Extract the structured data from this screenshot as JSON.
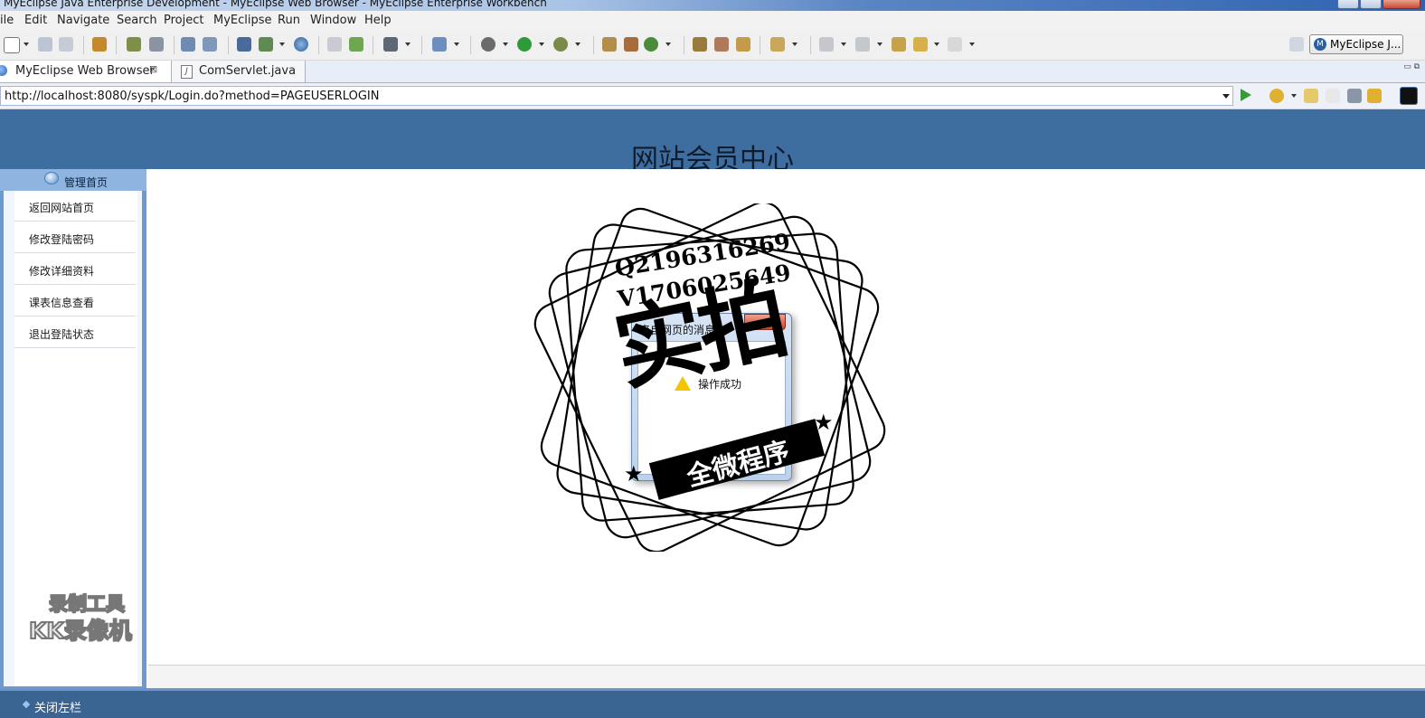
{
  "window": {
    "title": "MyEclipse Java Enterprise Development - MyEclipse Web Browser - MyEclipse Enterprise Workbench"
  },
  "menu": [
    "ile",
    "Edit",
    "Navigate",
    "Search",
    "Project",
    "MyEclipse",
    "Run",
    "Window",
    "Help"
  ],
  "perspective": {
    "label": "MyEclipse J..."
  },
  "tabs": {
    "active": {
      "label": "MyEclipse Web Browser",
      "close": "⊠"
    },
    "second": {
      "label": "ComServlet.java",
      "icon_text": "J"
    }
  },
  "address": {
    "url": "http://localhost:8080/syspk/Login.do?method=PAGEUSERLOGIN"
  },
  "page": {
    "title": "网站会员中心",
    "sidebar_header": "管理首页",
    "nav": [
      "返回网站首页",
      "修改登陆密码",
      "修改详细资料",
      "课表信息查看",
      "退出登陆状态"
    ],
    "bottom_link": "关闭左栏"
  },
  "dialog": {
    "title": "来自网页的消息",
    "message": "操作成功"
  },
  "watermark": {
    "qq": "Q2196316269",
    "v": "V1706025649",
    "big": "实拍",
    "ribbon": "全微程序",
    "recorder_line1": "录制工具",
    "recorder_line2": "KK录像机"
  },
  "colors": {
    "banner": "#3e6e9f",
    "sidebar": "#6c9ad0",
    "statusbar": "#3a6491"
  }
}
